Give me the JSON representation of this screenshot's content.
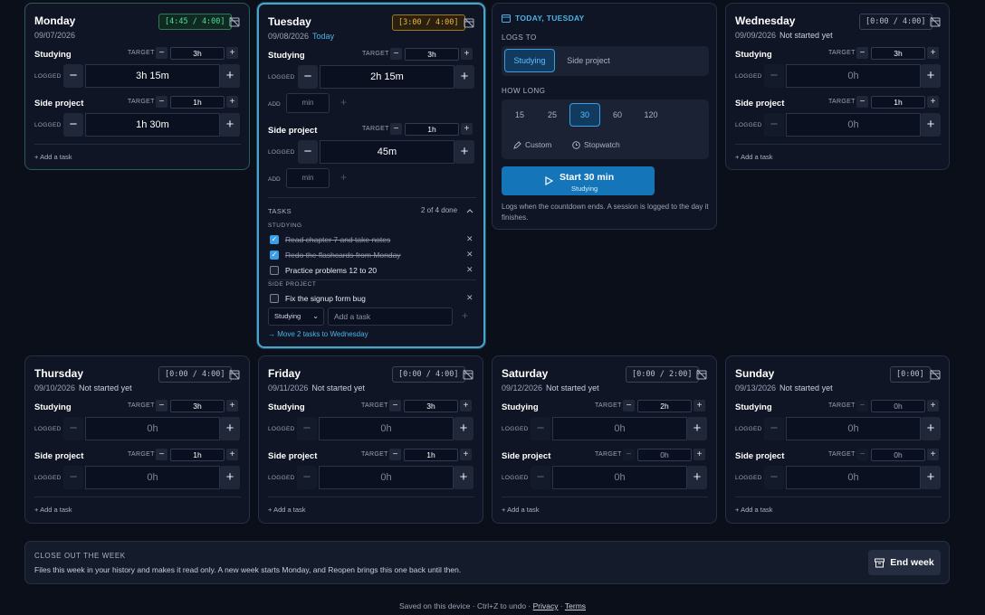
{
  "days": {
    "monday": {
      "name": "Monday",
      "date": "09/07/2026",
      "status": "",
      "badge": "[4:45 / 4:00]",
      "rows": [
        {
          "label": "Studying",
          "target": "3h",
          "logged": "3h 15m"
        },
        {
          "label": "Side project",
          "target": "1h",
          "logged": "1h 30m"
        }
      ],
      "add_task": "Add a task"
    },
    "tuesday": {
      "name": "Tuesday",
      "date": "09/08/2026",
      "status": "Today",
      "badge": "[3:00 / 4:00]",
      "rows": [
        {
          "label": "Studying",
          "target": "3h",
          "logged": "2h 15m"
        },
        {
          "label": "Side project",
          "target": "1h",
          "logged": "45m"
        }
      ],
      "add_label": "ADD",
      "min_placeholder": "min",
      "tasks": {
        "title": "TASKS",
        "count": "2 of 4 done",
        "groups": [
          {
            "label": "STUDYING",
            "items": [
              {
                "text": "Read chapter 7 and take notes",
                "done": true
              },
              {
                "text": "Redo the flashcards from Monday",
                "done": true
              },
              {
                "text": "Practice problems 12 to 20",
                "done": false
              }
            ]
          },
          {
            "label": "SIDE PROJECT",
            "items": [
              {
                "text": "Fix the signup form bug",
                "done": false
              }
            ]
          }
        ],
        "select_value": "Studying",
        "add_placeholder": "Add a task",
        "move_link": "Move 2 tasks to Wednesday"
      }
    },
    "wednesday": {
      "name": "Wednesday",
      "date": "09/09/2026",
      "status": "Not started yet",
      "badge": "[0:00 / 4:00]",
      "rows": [
        {
          "label": "Studying",
          "target": "3h",
          "logged": "0h"
        },
        {
          "label": "Side project",
          "target": "1h",
          "logged": "0h"
        }
      ],
      "add_task": "Add a task"
    },
    "thursday": {
      "name": "Thursday",
      "date": "09/10/2026",
      "status": "Not started yet",
      "badge": "[0:00 / 4:00]",
      "rows": [
        {
          "label": "Studying",
          "target": "3h",
          "logged": "0h"
        },
        {
          "label": "Side project",
          "target": "1h",
          "logged": "0h"
        }
      ],
      "add_task": "Add a task"
    },
    "friday": {
      "name": "Friday",
      "date": "09/11/2026",
      "status": "Not started yet",
      "badge": "[0:00 / 4:00]",
      "rows": [
        {
          "label": "Studying",
          "target": "3h",
          "logged": "0h"
        },
        {
          "label": "Side project",
          "target": "1h",
          "logged": "0h"
        }
      ],
      "add_task": "Add a task"
    },
    "saturday": {
      "name": "Saturday",
      "date": "09/12/2026",
      "status": "Not started yet",
      "badge": "[0:00 / 2:00]",
      "rows": [
        {
          "label": "Studying",
          "target": "2h",
          "logged": "0h"
        },
        {
          "label": "Side project",
          "target": "0h",
          "logged": "0h"
        }
      ],
      "add_task": "Add a task"
    },
    "sunday": {
      "name": "Sunday",
      "date": "09/13/2026",
      "status": "Not started yet",
      "badge": "[0:00]",
      "rows": [
        {
          "label": "Studying",
          "target": "0h",
          "logged": "0h"
        },
        {
          "label": "Side project",
          "target": "0h",
          "logged": "0h"
        }
      ],
      "add_task": "Add a task"
    }
  },
  "labels": {
    "target": "TARGET",
    "logged": "LOGGED",
    "minus": "−",
    "plus": "+"
  },
  "timer": {
    "header": "TODAY, TUESDAY",
    "logs_to_label": "LOGS TO",
    "logs_to_options": [
      "Studying",
      "Side project"
    ],
    "selected_logs_to": "Studying",
    "how_long_label": "HOW LONG",
    "durations": [
      "15",
      "25",
      "30",
      "60",
      "120"
    ],
    "selected_duration": "30",
    "custom_label": "Custom",
    "stopwatch_label": "Stopwatch",
    "start_label": "Start 30 min",
    "start_sub": "Studying",
    "hint": "Logs when the countdown ends. A session is logged to the day it finishes."
  },
  "close_out": {
    "title": "CLOSE OUT THE WEEK",
    "text": "Files this week in your history and makes it read only. A new week starts Monday, and Reopen brings this one back until then.",
    "button": "End week"
  },
  "footer": {
    "text": "Saved on this device · Ctrl+Z to undo · ",
    "privacy": "Privacy",
    "sep": " · ",
    "terms": "Terms"
  },
  "colors": {
    "accent": "#4ab3e6",
    "primary_button": "#1476b8",
    "badge_over": "#4ade9a",
    "badge_partial": "#f0b43c"
  }
}
